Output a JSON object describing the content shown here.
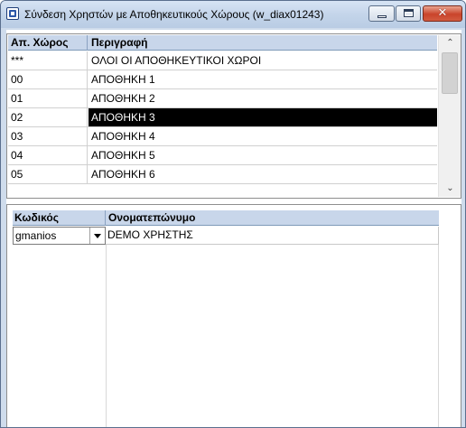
{
  "window": {
    "title": "Σύνδεση Χρηστών με Αποθηκευτικούς Χώρους  (w_diax01243)",
    "close_symbol": "✕"
  },
  "storage_grid": {
    "columns": [
      "Απ. Χώρος",
      "Περιγραφή"
    ],
    "rows": [
      {
        "code": "***",
        "description": "ΟΛΟΙ ΟΙ ΑΠΟΘΗΚΕΥΤΙΚΟΙ ΧΩΡΟΙ"
      },
      {
        "code": "00",
        "description": "ΑΠΟΘΗΚΗ 1"
      },
      {
        "code": "01",
        "description": "ΑΠΟΘΗΚΗ 2"
      },
      {
        "code": "02",
        "description": "ΑΠΟΘΗΚΗ 3"
      },
      {
        "code": "03",
        "description": "ΑΠΟΘΗΚΗ 4"
      },
      {
        "code": "04",
        "description": "ΑΠΟΘΗΚΗ 5"
      },
      {
        "code": "05",
        "description": "ΑΠΟΘΗΚΗ 6"
      }
    ],
    "selected_index": 3,
    "scroll_up_symbol": "⌃",
    "scroll_down_symbol": "⌄"
  },
  "users_grid": {
    "columns": [
      "Κωδικός",
      "Ονοματεπώνυμο"
    ],
    "rows": [
      {
        "code": "gmanios",
        "name": "DEMO ΧΡΗΣΤΗΣ"
      }
    ]
  }
}
